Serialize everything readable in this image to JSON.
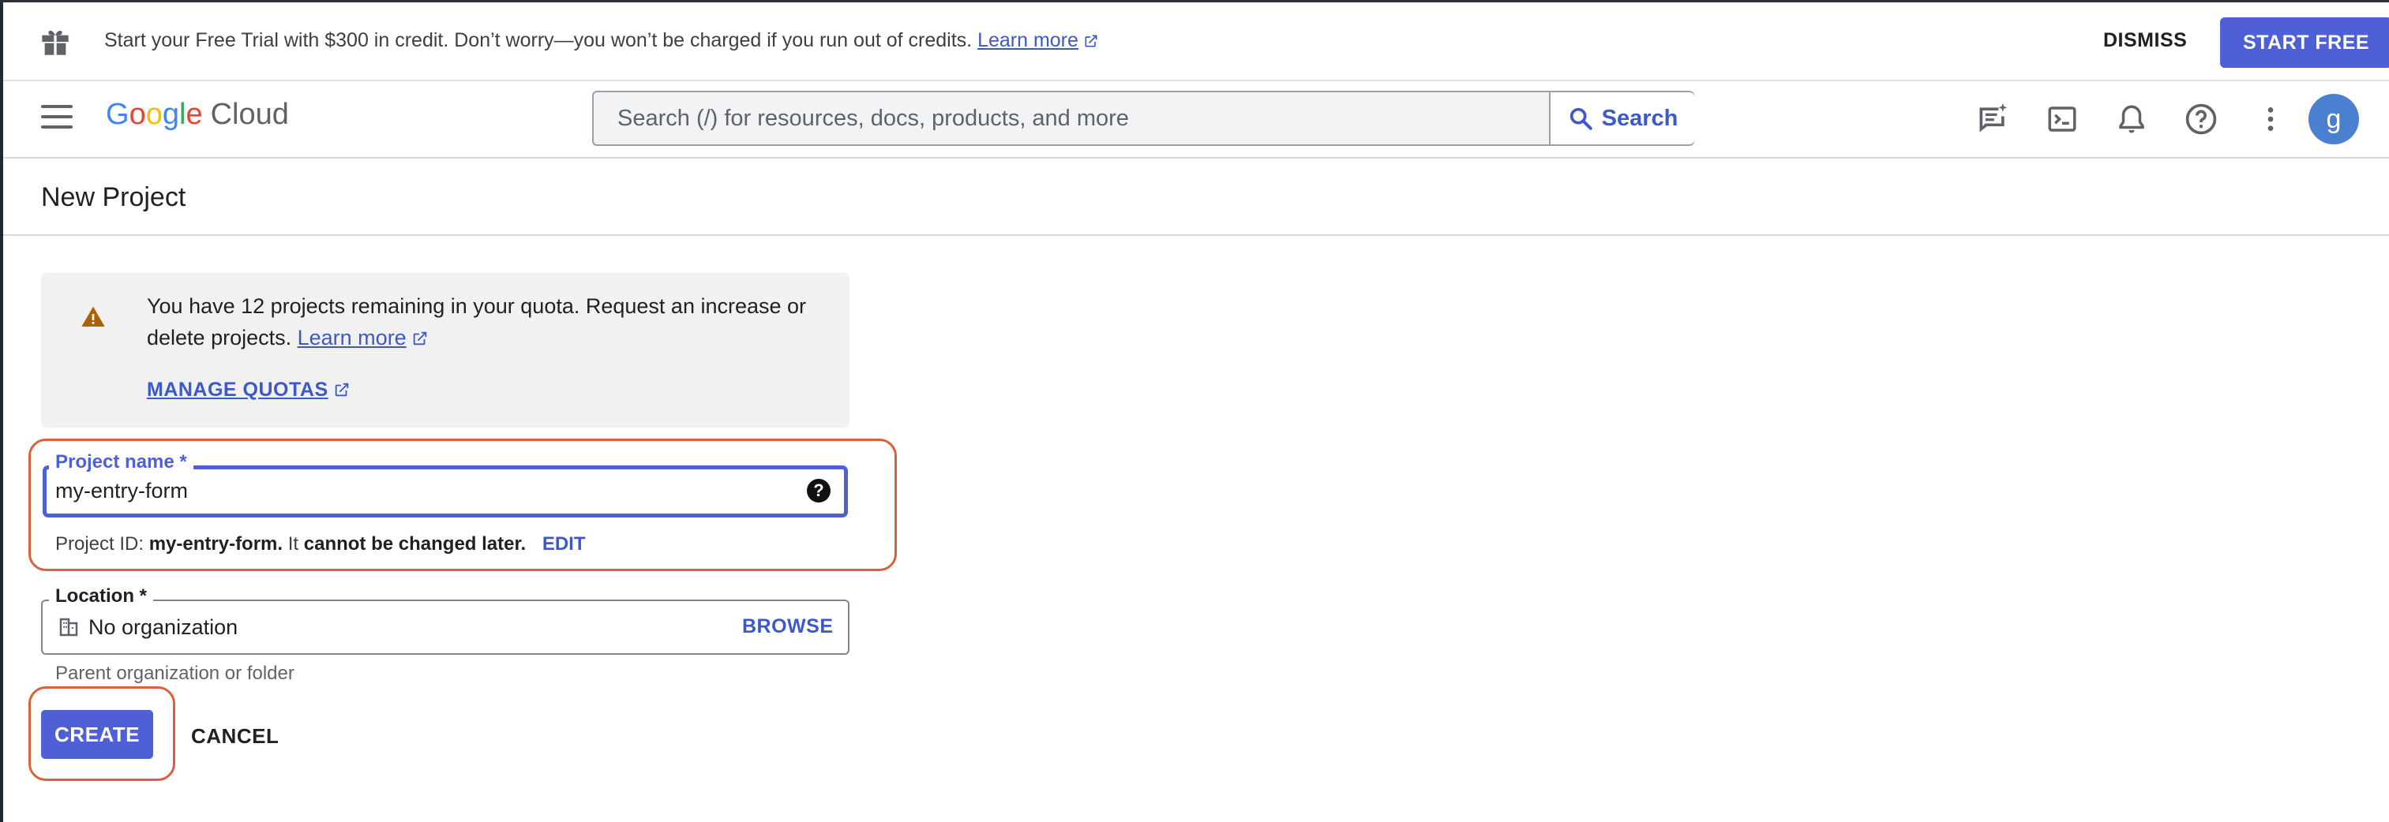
{
  "banner": {
    "message": "Start your Free Trial with $300 in credit. Don’t worry—you won’t be charged if you run out of credits.",
    "learn_more": "Learn more",
    "dismiss": "DISMISS",
    "start_free": "START FREE"
  },
  "header": {
    "logo_google": [
      "G",
      "o",
      "o",
      "g",
      "l",
      "e"
    ],
    "logo_cloud": "Cloud",
    "search_placeholder": "Search (/) for resources, docs, products, and more",
    "search_button": "Search",
    "avatar_initial": "g",
    "icons": [
      "feedback-icon",
      "cloud-shell-icon",
      "notifications-icon",
      "help-icon",
      "more-vert-icon"
    ]
  },
  "page": {
    "title": "New Project"
  },
  "quota_notice": {
    "text": "You have 12 projects remaining in your quota. Request an increase or delete projects.",
    "learn_more": "Learn more",
    "manage_quotas": "MANAGE QUOTAS"
  },
  "form": {
    "project_name": {
      "label": "Project name *",
      "value": "my-entry-form",
      "id_prefix": "Project ID:",
      "id_value": "my-entry-form.",
      "id_middle": "It",
      "id_suffix": "cannot be changed later.",
      "edit": "EDIT"
    },
    "location": {
      "label": "Location *",
      "value": "No organization",
      "browse": "BROWSE",
      "helper": "Parent organization or folder"
    },
    "create": "CREATE",
    "cancel": "CANCEL"
  },
  "colors": {
    "primary": "#4f5fd6",
    "link": "#3c58c9",
    "annotation": "#d9623a",
    "warning": "#b06000"
  }
}
